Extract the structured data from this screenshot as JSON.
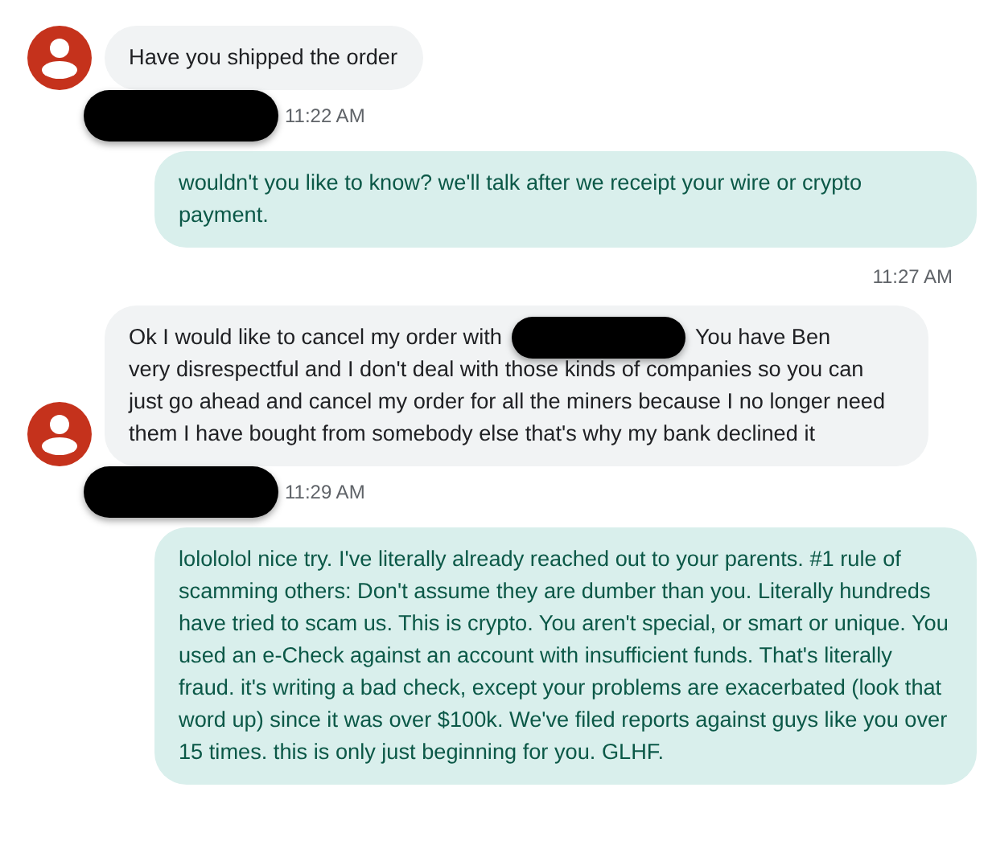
{
  "messages": [
    {
      "kind": "incoming",
      "parts": [
        {
          "kind": "text",
          "text": "Have you shipped the order"
        }
      ],
      "sender_redacted": true,
      "time": "11:22 AM"
    },
    {
      "kind": "outgoing",
      "parts": [
        {
          "kind": "text",
          "text": "wouldn't you like to know? we'll talk after we receipt your wire or crypto payment."
        }
      ],
      "time": "11:27 AM"
    },
    {
      "kind": "incoming",
      "parts": [
        {
          "kind": "text",
          "text": "Ok I would like to cancel my order with"
        },
        {
          "kind": "redaction"
        },
        {
          "kind": "text",
          "text": "You have Ben"
        },
        {
          "kind": "text_block",
          "text": "very disrespectful and I don't deal with those kinds of companies so you can just go ahead and cancel my order for all the miners because I no longer need them I have bought from somebody else that's why my bank declined it"
        }
      ],
      "sender_redacted": true,
      "time": "11:29 AM"
    },
    {
      "kind": "outgoing",
      "parts": [
        {
          "kind": "text",
          "text": "lolololol nice try. I've literally already reached out to your parents. #1 rule of scamming others: Don't assume they are dumber than you. Literally hundreds have tried to scam us. This is crypto. You aren't special, or smart or unique. You used an e-Check against an account with insufficient funds. That's literally fraud. it's writing a bad check, except your problems are exacerbated (look that word up) since it was over $100k. We've filed reports against guys like you over 15 times. this is only just beginning for you. GLHF."
        }
      ]
    }
  ]
}
